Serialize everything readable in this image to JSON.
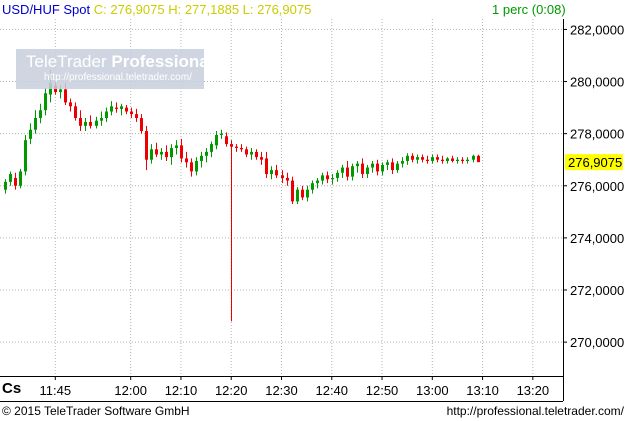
{
  "header": {
    "pair": "USD/HUF Spot",
    "ohlc": "C: 276,9075 H: 277,1885 L: 276,9075",
    "interval": "1 perc (0:08)"
  },
  "logo": {
    "brand_regular": "TeleTrader",
    "brand_bold": "Professional",
    "url": "http://professional.teletrader.com/"
  },
  "axis_label": "Cs",
  "footer": {
    "copyright": "© 2015 TeleTrader Software GmbH",
    "site": "http://professional.teletrader.com/"
  },
  "colors": {
    "up": "#009900",
    "down": "#ee0000",
    "grid": "#b4b4b4",
    "last_price_bg": "#ffff00",
    "axis_line": "#000000"
  },
  "chart_data": {
    "type": "candlestick",
    "title": "USD/HUF Spot",
    "xlabel": "Cs",
    "ylabel": "",
    "last_price_label": "276,9075",
    "x_ticks": [
      "11:45",
      "12:00",
      "12:10",
      "12:20",
      "12:30",
      "12:40",
      "12:50",
      "13:00",
      "13:10",
      "13:20"
    ],
    "x_tick_times": [
      "11:45",
      "12:00",
      "12:10",
      "12:20",
      "12:30",
      "12:40",
      "12:50",
      "13:00",
      "13:10",
      "13:20"
    ],
    "y_ticks": [
      "282,0000",
      "280,0000",
      "278,0000",
      "276,0000",
      "274,0000",
      "272,0000",
      "270,0000"
    ],
    "y_tick_values": [
      282,
      280,
      278,
      276,
      274,
      272,
      270
    ],
    "ylim": [
      268.7,
      282.4
    ],
    "xlim": [
      "11:34",
      "13:26"
    ],
    "grid": true,
    "candles": [
      {
        "t": "11:35",
        "o": 275.85,
        "h": 276.25,
        "l": 275.7,
        "c": 276.15
      },
      {
        "t": "11:36",
        "o": 276.15,
        "h": 276.55,
        "l": 276.0,
        "c": 276.45
      },
      {
        "t": "11:37",
        "o": 276.3,
        "h": 276.5,
        "l": 275.85,
        "c": 276.0
      },
      {
        "t": "11:38",
        "o": 276.0,
        "h": 276.65,
        "l": 275.9,
        "c": 276.55
      },
      {
        "t": "11:39",
        "o": 276.55,
        "h": 277.95,
        "l": 276.4,
        "c": 277.75
      },
      {
        "t": "11:40",
        "o": 277.8,
        "h": 278.4,
        "l": 277.6,
        "c": 278.15
      },
      {
        "t": "11:41",
        "o": 278.15,
        "h": 278.9,
        "l": 278.0,
        "c": 278.6
      },
      {
        "t": "11:42",
        "o": 278.6,
        "h": 279.15,
        "l": 278.4,
        "c": 278.9
      },
      {
        "t": "11:43",
        "o": 278.9,
        "h": 279.75,
        "l": 278.7,
        "c": 279.55
      },
      {
        "t": "11:44",
        "o": 279.5,
        "h": 280.45,
        "l": 279.2,
        "c": 279.95
      },
      {
        "t": "11:45",
        "o": 279.85,
        "h": 280.0,
        "l": 279.5,
        "c": 279.6
      },
      {
        "t": "11:46",
        "o": 279.6,
        "h": 279.85,
        "l": 279.35,
        "c": 279.7
      },
      {
        "t": "11:47",
        "o": 279.7,
        "h": 279.95,
        "l": 279.1,
        "c": 279.2
      },
      {
        "t": "11:48",
        "o": 279.2,
        "h": 279.35,
        "l": 278.85,
        "c": 279.05
      },
      {
        "t": "11:49",
        "o": 279.05,
        "h": 279.2,
        "l": 278.5,
        "c": 278.6
      },
      {
        "t": "11:50",
        "o": 278.6,
        "h": 278.9,
        "l": 278.1,
        "c": 278.3
      },
      {
        "t": "11:51",
        "o": 278.3,
        "h": 278.6,
        "l": 278.1,
        "c": 278.45
      },
      {
        "t": "11:52",
        "o": 278.45,
        "h": 278.7,
        "l": 278.2,
        "c": 278.3
      },
      {
        "t": "11:53",
        "o": 278.3,
        "h": 278.65,
        "l": 278.2,
        "c": 278.5
      },
      {
        "t": "11:54",
        "o": 278.5,
        "h": 278.85,
        "l": 278.3,
        "c": 278.6
      },
      {
        "t": "11:55",
        "o": 278.6,
        "h": 279.0,
        "l": 278.45,
        "c": 278.85
      },
      {
        "t": "11:56",
        "o": 278.85,
        "h": 279.25,
        "l": 278.7,
        "c": 279.05
      },
      {
        "t": "11:57",
        "o": 279.0,
        "h": 279.2,
        "l": 278.8,
        "c": 278.95
      },
      {
        "t": "11:58",
        "o": 278.95,
        "h": 279.15,
        "l": 278.7,
        "c": 279.05
      },
      {
        "t": "11:59",
        "o": 279.0,
        "h": 279.1,
        "l": 278.75,
        "c": 278.85
      },
      {
        "t": "12:00",
        "o": 278.85,
        "h": 279.0,
        "l": 278.6,
        "c": 278.75
      },
      {
        "t": "12:01",
        "o": 278.75,
        "h": 278.95,
        "l": 278.45,
        "c": 278.6
      },
      {
        "t": "12:02",
        "o": 278.6,
        "h": 278.75,
        "l": 278.0,
        "c": 278.1
      },
      {
        "t": "12:03",
        "o": 278.1,
        "h": 278.3,
        "l": 276.6,
        "c": 277.0
      },
      {
        "t": "12:04",
        "o": 277.0,
        "h": 277.6,
        "l": 276.85,
        "c": 277.4
      },
      {
        "t": "12:05",
        "o": 277.4,
        "h": 277.65,
        "l": 277.1,
        "c": 277.2
      },
      {
        "t": "12:06",
        "o": 277.2,
        "h": 277.45,
        "l": 277.0,
        "c": 277.3
      },
      {
        "t": "12:07",
        "o": 277.3,
        "h": 277.55,
        "l": 276.95,
        "c": 277.1
      },
      {
        "t": "12:08",
        "o": 277.1,
        "h": 277.6,
        "l": 276.8,
        "c": 277.45
      },
      {
        "t": "12:09",
        "o": 277.45,
        "h": 277.75,
        "l": 277.2,
        "c": 277.55
      },
      {
        "t": "12:10",
        "o": 277.55,
        "h": 277.8,
        "l": 276.9,
        "c": 277.05
      },
      {
        "t": "12:11",
        "o": 277.05,
        "h": 277.3,
        "l": 276.7,
        "c": 276.9
      },
      {
        "t": "12:12",
        "o": 276.9,
        "h": 277.05,
        "l": 276.35,
        "c": 276.55
      },
      {
        "t": "12:13",
        "o": 276.55,
        "h": 277.1,
        "l": 276.4,
        "c": 276.95
      },
      {
        "t": "12:14",
        "o": 276.95,
        "h": 277.3,
        "l": 276.7,
        "c": 277.15
      },
      {
        "t": "12:15",
        "o": 277.15,
        "h": 277.45,
        "l": 276.9,
        "c": 277.3
      },
      {
        "t": "12:16",
        "o": 277.3,
        "h": 277.7,
        "l": 277.1,
        "c": 277.6
      },
      {
        "t": "12:17",
        "o": 277.55,
        "h": 278.1,
        "l": 277.4,
        "c": 277.95
      },
      {
        "t": "12:18",
        "o": 277.95,
        "h": 278.15,
        "l": 277.8,
        "c": 278.0
      },
      {
        "t": "12:19",
        "o": 277.9,
        "h": 278.05,
        "l": 277.5,
        "c": 277.6
      },
      {
        "t": "12:20",
        "o": 277.6,
        "h": 277.75,
        "l": 270.8,
        "c": 277.5
      },
      {
        "t": "12:21",
        "o": 277.5,
        "h": 277.6,
        "l": 277.3,
        "c": 277.45
      },
      {
        "t": "12:22",
        "o": 277.45,
        "h": 277.6,
        "l": 277.3,
        "c": 277.4
      },
      {
        "t": "12:23",
        "o": 277.4,
        "h": 277.5,
        "l": 277.1,
        "c": 277.2
      },
      {
        "t": "12:24",
        "o": 277.2,
        "h": 277.45,
        "l": 277.0,
        "c": 277.3
      },
      {
        "t": "12:25",
        "o": 277.3,
        "h": 277.4,
        "l": 277.0,
        "c": 277.1
      },
      {
        "t": "12:26",
        "o": 277.1,
        "h": 277.3,
        "l": 276.8,
        "c": 277.0
      },
      {
        "t": "12:27",
        "o": 277.05,
        "h": 277.3,
        "l": 276.3,
        "c": 276.45
      },
      {
        "t": "12:28",
        "o": 276.45,
        "h": 276.75,
        "l": 276.25,
        "c": 276.6
      },
      {
        "t": "12:29",
        "o": 276.6,
        "h": 276.8,
        "l": 276.3,
        "c": 276.4
      },
      {
        "t": "12:30",
        "o": 276.4,
        "h": 276.6,
        "l": 276.1,
        "c": 276.3
      },
      {
        "t": "12:31",
        "o": 276.3,
        "h": 276.5,
        "l": 276.0,
        "c": 276.2
      },
      {
        "t": "12:32",
        "o": 276.2,
        "h": 276.35,
        "l": 275.3,
        "c": 275.4
      },
      {
        "t": "12:33",
        "o": 275.4,
        "h": 275.95,
        "l": 275.3,
        "c": 275.85
      },
      {
        "t": "12:34",
        "o": 275.85,
        "h": 276.0,
        "l": 275.45,
        "c": 275.55
      },
      {
        "t": "12:35",
        "o": 275.55,
        "h": 276.0,
        "l": 275.4,
        "c": 275.85
      },
      {
        "t": "12:36",
        "o": 275.85,
        "h": 276.2,
        "l": 275.7,
        "c": 276.1
      },
      {
        "t": "12:37",
        "o": 276.1,
        "h": 276.3,
        "l": 275.9,
        "c": 276.2
      },
      {
        "t": "12:38",
        "o": 276.2,
        "h": 276.5,
        "l": 276.05,
        "c": 276.4
      },
      {
        "t": "12:39",
        "o": 276.4,
        "h": 276.55,
        "l": 276.1,
        "c": 276.25
      },
      {
        "t": "12:40",
        "o": 276.25,
        "h": 276.45,
        "l": 276.05,
        "c": 276.3
      },
      {
        "t": "12:41",
        "o": 276.3,
        "h": 276.6,
        "l": 276.15,
        "c": 276.5
      },
      {
        "t": "12:42",
        "o": 276.5,
        "h": 276.8,
        "l": 276.3,
        "c": 276.7
      },
      {
        "t": "12:43",
        "o": 276.7,
        "h": 276.95,
        "l": 276.2,
        "c": 276.35
      },
      {
        "t": "12:44",
        "o": 276.35,
        "h": 276.85,
        "l": 276.2,
        "c": 276.75
      },
      {
        "t": "12:45",
        "o": 276.75,
        "h": 276.95,
        "l": 276.5,
        "c": 276.85
      },
      {
        "t": "12:46",
        "o": 276.85,
        "h": 277.05,
        "l": 276.3,
        "c": 276.45
      },
      {
        "t": "12:47",
        "o": 276.45,
        "h": 276.8,
        "l": 276.3,
        "c": 276.7
      },
      {
        "t": "12:48",
        "o": 276.7,
        "h": 276.95,
        "l": 276.5,
        "c": 276.85
      },
      {
        "t": "12:49",
        "o": 276.85,
        "h": 277.0,
        "l": 276.4,
        "c": 276.55
      },
      {
        "t": "12:50",
        "o": 276.55,
        "h": 276.9,
        "l": 276.4,
        "c": 276.8
      },
      {
        "t": "12:51",
        "o": 276.8,
        "h": 277.0,
        "l": 276.6,
        "c": 276.9
      },
      {
        "t": "12:52",
        "o": 276.9,
        "h": 277.05,
        "l": 276.45,
        "c": 276.6
      },
      {
        "t": "12:53",
        "o": 276.6,
        "h": 276.95,
        "l": 276.5,
        "c": 276.85
      },
      {
        "t": "12:54",
        "o": 276.85,
        "h": 277.1,
        "l": 276.7,
        "c": 276.95
      },
      {
        "t": "12:55",
        "o": 276.95,
        "h": 277.25,
        "l": 276.8,
        "c": 277.15
      },
      {
        "t": "12:56",
        "o": 277.15,
        "h": 277.25,
        "l": 276.9,
        "c": 277.0
      },
      {
        "t": "12:57",
        "o": 277.0,
        "h": 277.2,
        "l": 276.85,
        "c": 277.1
      },
      {
        "t": "12:58",
        "o": 277.1,
        "h": 277.2,
        "l": 276.9,
        "c": 277.0
      },
      {
        "t": "12:59",
        "o": 277.0,
        "h": 277.15,
        "l": 276.85,
        "c": 276.95
      },
      {
        "t": "13:00",
        "o": 276.95,
        "h": 277.2,
        "l": 276.85,
        "c": 277.1
      },
      {
        "t": "13:01",
        "o": 277.1,
        "h": 277.2,
        "l": 276.9,
        "c": 277.0
      },
      {
        "t": "13:02",
        "o": 277.0,
        "h": 277.15,
        "l": 276.85,
        "c": 276.95
      },
      {
        "t": "13:03",
        "o": 276.95,
        "h": 277.1,
        "l": 276.85,
        "c": 277.05
      },
      {
        "t": "13:04",
        "o": 277.05,
        "h": 277.15,
        "l": 276.9,
        "c": 276.95
      },
      {
        "t": "13:05",
        "o": 276.95,
        "h": 277.1,
        "l": 276.85,
        "c": 277.0
      },
      {
        "t": "13:06",
        "o": 277.0,
        "h": 277.1,
        "l": 276.85,
        "c": 276.95
      },
      {
        "t": "13:07",
        "o": 276.95,
        "h": 277.1,
        "l": 276.85,
        "c": 277.0
      },
      {
        "t": "13:08",
        "o": 277.0,
        "h": 277.1885,
        "l": 276.9,
        "c": 277.15
      },
      {
        "t": "13:09",
        "o": 277.15,
        "h": 277.1885,
        "l": 276.9075,
        "c": 276.9075
      }
    ]
  }
}
